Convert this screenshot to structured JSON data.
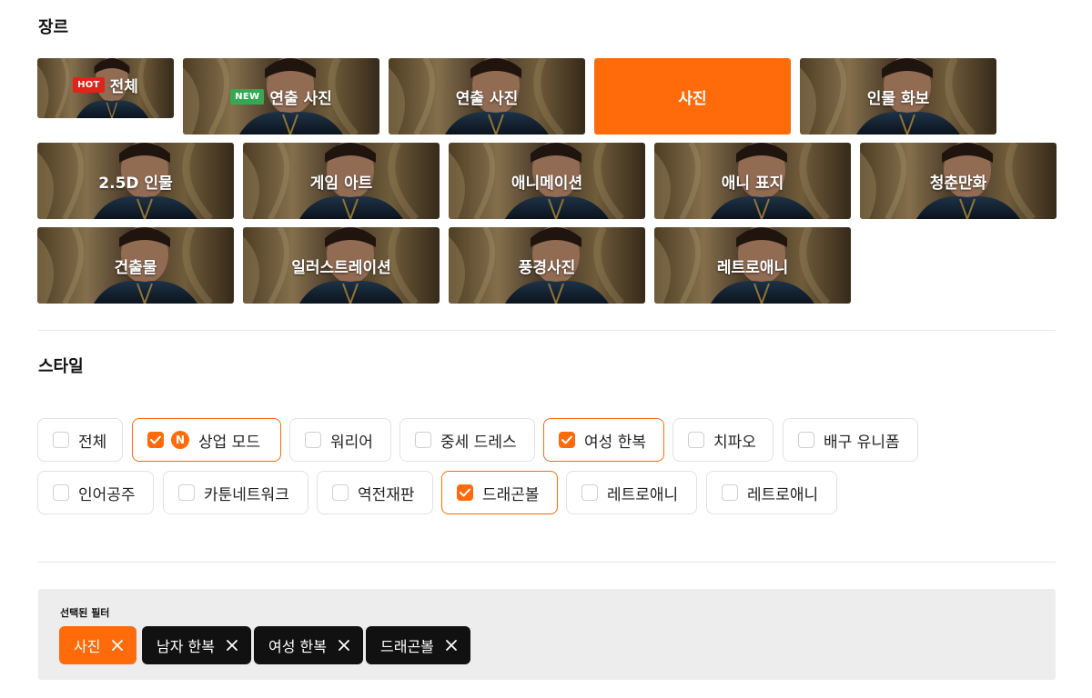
{
  "genre": {
    "title": "장르",
    "tiles": [
      {
        "label": "전체",
        "badge": "HOT"
      },
      {
        "label": "연출 사진",
        "badge": "NEW"
      },
      {
        "label": "연출 사진"
      },
      {
        "label": "사진",
        "selected": true
      },
      {
        "label": "인물 화보"
      },
      {
        "label": "2.5D 인물"
      },
      {
        "label": "게임 아트"
      },
      {
        "label": "애니메이션"
      },
      {
        "label": "애니 표지"
      },
      {
        "label": "청춘만화"
      },
      {
        "label": "건출물"
      },
      {
        "label": "일러스트레이션"
      },
      {
        "label": "풍경사진"
      },
      {
        "label": "레트로애니"
      }
    ]
  },
  "style": {
    "title": "스타일",
    "chips": [
      {
        "label": "전체",
        "checked": false
      },
      {
        "label": "상업 모드",
        "checked": true,
        "badge": "N"
      },
      {
        "label": "워리어",
        "checked": false
      },
      {
        "label": "중세 드레스",
        "checked": false
      },
      {
        "label": "여성 한복",
        "checked": true
      },
      {
        "label": "치파오",
        "checked": false
      },
      {
        "label": "배구 유니폼",
        "checked": false
      },
      {
        "label": "인어공주",
        "checked": false
      },
      {
        "label": "카툰네트워크",
        "checked": false
      },
      {
        "label": "역전재판",
        "checked": false
      },
      {
        "label": "드래곤볼",
        "checked": true
      },
      {
        "label": "레트로애니",
        "checked": false
      },
      {
        "label": "레트로애니",
        "checked": false
      }
    ]
  },
  "selected_filters": {
    "title": "선택된 필터",
    "tags": [
      {
        "label": "사진",
        "accent": true
      },
      {
        "label": "남자 한복"
      },
      {
        "label": "여성 한복"
      },
      {
        "label": "드래곤볼"
      }
    ]
  },
  "colors": {
    "accent": "#ff6b0a",
    "hot_badge": "#e0231b",
    "new_badge": "#35a852",
    "tag_dark": "#111111",
    "panel_bg": "#ededed"
  }
}
